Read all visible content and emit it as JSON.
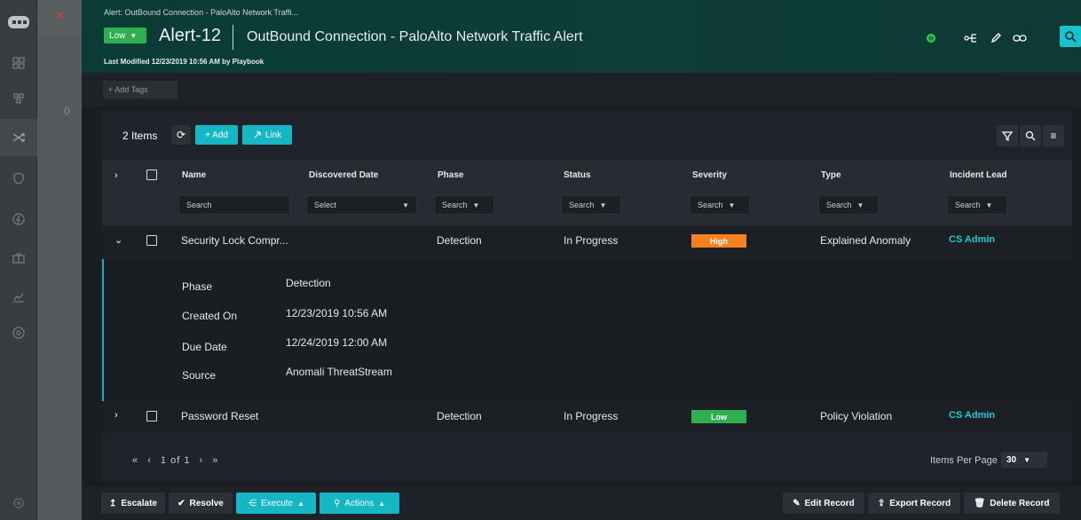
{
  "header": {
    "breadcrumb": "Alert: OutBound Connection - PaloAlto Network Traffi...",
    "severity_label": "Low",
    "alert_id": "Alert-12",
    "alert_title": "OutBound Connection - PaloAlto Network Traffic Alert",
    "last_modified": "Last Modified 12/23/2019 10:56 AM by Playbook"
  },
  "tags": {
    "add_label": "+ Add Tags"
  },
  "sidebar": {
    "counter": "0"
  },
  "toolbar": {
    "item_count": "2 Items",
    "add_label": "+ Add",
    "link_label": "Link"
  },
  "table": {
    "columns": [
      "Name",
      "Discovered Date",
      "Phase",
      "Status",
      "Severity",
      "Type",
      "Incident Lead"
    ],
    "filters": {
      "name": "Search",
      "discovered": "Select",
      "phase": "Search",
      "status": "Search",
      "severity": "Search",
      "type": "Search",
      "lead": "Search"
    },
    "rows": [
      {
        "name": "Security Lock Compr...",
        "phase": "Detection",
        "status": "In Progress",
        "severity": "High",
        "severity_color": "#f5821f",
        "type": "Explained Anomaly",
        "lead": "CS Admin"
      },
      {
        "name": "Password Reset",
        "phase": "Detection",
        "status": "In Progress",
        "severity": "Low",
        "severity_color": "#2fae52",
        "type": "Policy Violation",
        "lead": "CS Admin"
      }
    ],
    "detail": {
      "phase_label": "Phase",
      "phase_value": "Detection",
      "created_label": "Created On",
      "created_value": "12/23/2019 10:56 AM",
      "due_label": "Due Date",
      "due_value": "12/24/2019 12:00 AM",
      "source_label": "Source",
      "source_value": "Anomali ThreatStream"
    }
  },
  "pagination": {
    "first": "«",
    "prev": "‹",
    "page_text": "1 of 1",
    "next": "›",
    "last": "»",
    "items_per_page_label": "Items Per Page",
    "items_per_page_value": "30"
  },
  "actions": {
    "escalate": "Escalate",
    "resolve": "Resolve",
    "execute": "Execute",
    "actions": "Actions",
    "edit": "Edit Record",
    "export": "Export Record",
    "delete": "Delete Record"
  },
  "colors": {
    "accent": "#15b7c5",
    "low": "#2fae52",
    "high": "#f5821f",
    "lead_link": "#22c7d4"
  },
  "icons": [
    "logo-icon",
    "close-icon",
    "dashboard-icon",
    "queue-icon",
    "shuffle-icon",
    "shield-icon",
    "bolt-icon",
    "briefcase-icon",
    "chart-icon",
    "gauge-icon",
    "settings-icon",
    "status-dot",
    "connect-icon",
    "edit-icon",
    "link-icon",
    "search-user-icon",
    "refresh-icon",
    "filter-icon",
    "search-icon",
    "menu-icon"
  ]
}
